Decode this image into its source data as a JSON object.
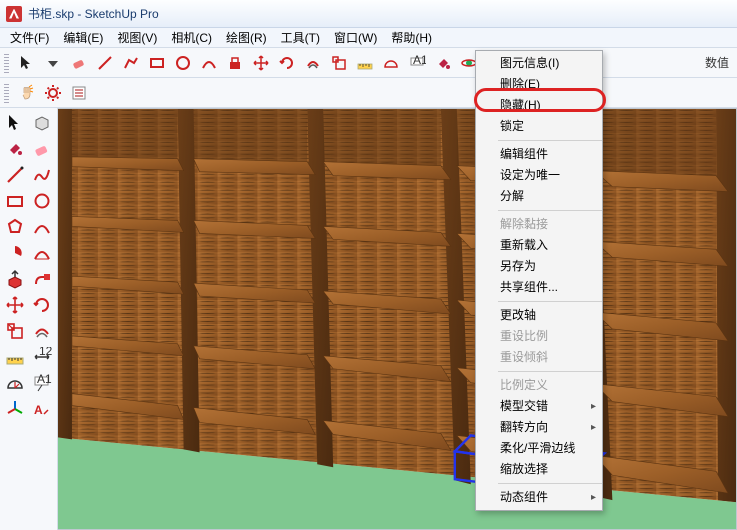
{
  "window": {
    "title": "书柜.skp - SketchUp Pro"
  },
  "menubar": [
    {
      "label": "文件(F)"
    },
    {
      "label": "编辑(E)"
    },
    {
      "label": "视图(V)"
    },
    {
      "label": "相机(C)"
    },
    {
      "label": "绘图(R)"
    },
    {
      "label": "工具(T)"
    },
    {
      "label": "窗口(W)"
    },
    {
      "label": "帮助(H)"
    }
  ],
  "toolbar_right_text": "数值",
  "context_menu": {
    "items": [
      {
        "label": "图元信息(I)",
        "enabled": true
      },
      {
        "label": "删除(E)",
        "enabled": true
      },
      {
        "label": "隐藏(H)",
        "enabled": true,
        "highlighted": true
      },
      {
        "label": "锁定",
        "enabled": true
      },
      {
        "sep": true
      },
      {
        "label": "编辑组件",
        "enabled": true
      },
      {
        "label": "设定为唯一",
        "enabled": true
      },
      {
        "label": "分解",
        "enabled": true
      },
      {
        "sep": true
      },
      {
        "label": "解除黏接",
        "enabled": false
      },
      {
        "label": "重新载入",
        "enabled": true
      },
      {
        "label": "另存为",
        "enabled": true
      },
      {
        "label": "共享组件...",
        "enabled": true
      },
      {
        "sep": true
      },
      {
        "label": "更改轴",
        "enabled": true
      },
      {
        "label": "重设比例",
        "enabled": false
      },
      {
        "label": "重设倾斜",
        "enabled": false
      },
      {
        "sep": true
      },
      {
        "label": "比例定义",
        "enabled": false
      },
      {
        "label": "模型交错",
        "enabled": true,
        "sub": true
      },
      {
        "label": "翻转方向",
        "enabled": true,
        "sub": true
      },
      {
        "label": "柔化/平滑边线",
        "enabled": true
      },
      {
        "label": "缩放选择",
        "enabled": true
      },
      {
        "sep": true
      },
      {
        "label": "动态组件",
        "enabled": true,
        "sub": true
      }
    ]
  }
}
